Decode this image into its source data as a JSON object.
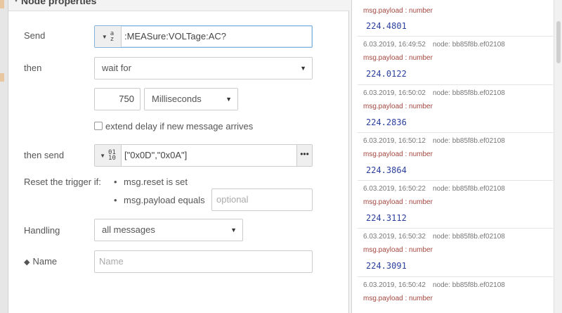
{
  "header": {
    "title": "Node properties"
  },
  "form": {
    "send_label": "Send",
    "send_value": ":MEASure:VOLTage:AC?",
    "send_type_icon": "az",
    "then_label": "then",
    "then_select": "wait for",
    "delay_value": "750",
    "delay_units": "Milliseconds",
    "extend_label": "extend delay if new message arrives",
    "then_send_label": "then send",
    "then_send_value": "[\"0x0D\",\"0x0A\"]",
    "then_send_type_icon": "0110",
    "expand_label": "•••",
    "reset_label": "Reset the trigger if:",
    "reset_item1": "msg.reset is set",
    "reset_item2": "msg.payload equals",
    "reset_placeholder": "optional",
    "handling_label": "Handling",
    "handling_select": "all messages",
    "name_label": "Name",
    "name_placeholder": "Name"
  },
  "debug": {
    "top_topic": "msg.payload : number",
    "top_value": "224.4801",
    "messages": [
      {
        "time": "6.03.2019, 16:49:52",
        "node": "node: bb85f8b.ef02108",
        "topic": "msg.payload : number",
        "value": "224.0122"
      },
      {
        "time": "6.03.2019, 16:50:02",
        "node": "node: bb85f8b.ef02108",
        "topic": "msg.payload : number",
        "value": "224.2836"
      },
      {
        "time": "6.03.2019, 16:50:12",
        "node": "node: bb85f8b.ef02108",
        "topic": "msg.payload : number",
        "value": "224.3864"
      },
      {
        "time": "6.03.2019, 16:50:22",
        "node": "node: bb85f8b.ef02108",
        "topic": "msg.payload : number",
        "value": "224.3112"
      },
      {
        "time": "6.03.2019, 16:50:32",
        "node": "node: bb85f8b.ef02108",
        "topic": "msg.payload : number",
        "value": "224.3091"
      },
      {
        "time": "6.03.2019, 16:50:42",
        "node": "node: bb85f8b.ef02108",
        "topic": "msg.payload : number",
        "value": ""
      }
    ]
  }
}
